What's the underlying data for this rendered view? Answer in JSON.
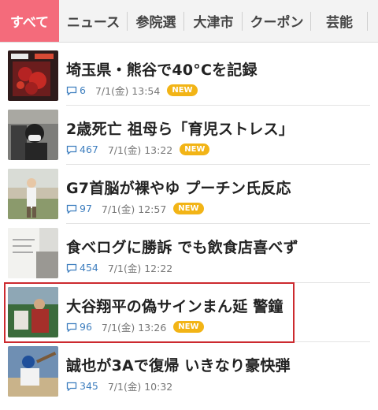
{
  "tabs": [
    {
      "label": "すべて",
      "active": true
    },
    {
      "label": "ニュース"
    },
    {
      "label": "参院選"
    },
    {
      "label": "大津市"
    },
    {
      "label": "クーポン"
    },
    {
      "label": "芸能"
    }
  ],
  "articles": [
    {
      "headline": "埼玉県・熊谷で40°Cを記録",
      "comments": "6",
      "time": "7/1(金) 13:54",
      "badge": "NEW"
    },
    {
      "headline": "2歳死亡 祖母ら「育児ストレス」",
      "comments": "467",
      "time": "7/1(金) 13:22",
      "badge": "NEW"
    },
    {
      "headline": "G7首脳が裸やゆ プーチン氏反応",
      "comments": "97",
      "time": "7/1(金) 12:57",
      "badge": "NEW"
    },
    {
      "headline": "食べログに勝訴 でも飲食店喜べず",
      "comments": "454",
      "time": "7/1(金) 12:22",
      "badge": ""
    },
    {
      "headline": "大谷翔平の偽サインまん延 警鐘",
      "comments": "96",
      "time": "7/1(金) 13:26",
      "badge": "NEW"
    },
    {
      "headline": "誠也が3Aで復帰 いきなり豪快弾",
      "comments": "345",
      "time": "7/1(金) 10:32",
      "badge": ""
    }
  ],
  "icons": {
    "comment": "comment-bubble-icon"
  },
  "colors": {
    "active_tab": "#f46b7b",
    "badge": "#f2b416",
    "count": "#3f7fbf",
    "highlight": "#cc2a2f"
  }
}
